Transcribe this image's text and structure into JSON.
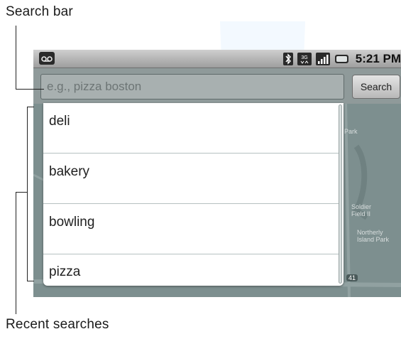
{
  "callouts": {
    "search_bar": "Search bar",
    "recent_searches": "Recent searches"
  },
  "status_bar": {
    "time": "5:21 PM",
    "icons": [
      "voicemail-icon",
      "bluetooth-icon",
      "3g-icon",
      "signal-icon",
      "battery-icon"
    ]
  },
  "search": {
    "placeholder": "e.g., pizza boston",
    "button_label": "Search"
  },
  "suggestions": [
    "deli",
    "bakery",
    "bowling",
    "pizza"
  ],
  "map": {
    "labels": [
      "Park",
      "Soldier Field II",
      "Northerly Island Park",
      "41"
    ]
  },
  "colors": {
    "map_bg": "#7d8f8f",
    "status_bar": "#b8b8b8",
    "dropdown_bg": "#ffffff"
  }
}
